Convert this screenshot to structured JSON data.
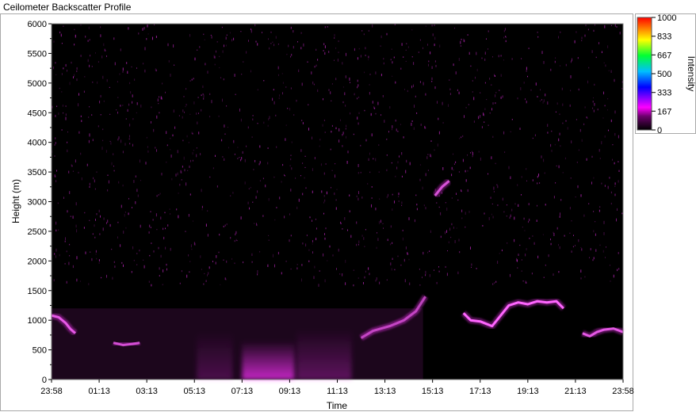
{
  "window": {
    "title": "Ceilometer Backscatter Profile"
  },
  "colors": {
    "background": "#000000",
    "accent": "#ff33ff",
    "colormap": [
      "#000000",
      "#6a006a",
      "#ff00ff",
      "#0000ff",
      "#00ffff",
      "#00ff00",
      "#ffff00",
      "#ff0000"
    ]
  },
  "chart_data": {
    "type": "heatmap",
    "title": "Ceilometer Backscatter Profile",
    "xlabel": "Time",
    "ylabel": "Height (m)",
    "x_ticks": [
      "23:58",
      "01:13",
      "03:13",
      "05:13",
      "07:13",
      "09:13",
      "11:13",
      "13:13",
      "15:13",
      "17:13",
      "19:13",
      "21:13",
      "23:58"
    ],
    "y_ticks": [
      0,
      500,
      1000,
      1500,
      2000,
      2500,
      3000,
      3500,
      4000,
      4500,
      5000,
      5500,
      6000
    ],
    "ylim": [
      0,
      6000
    ],
    "colorbar": {
      "label": "Intensity",
      "range": [
        0,
        1000
      ],
      "ticks": [
        0,
        167,
        333,
        500,
        667,
        833,
        1000
      ]
    },
    "layers": [
      {
        "feature": "boundary layer",
        "hours": [
          0,
          15.6
        ],
        "top_m": 1200,
        "intensity": 120
      }
    ],
    "cloud_base": [
      {
        "x": [
          0,
          0.3,
          0.6,
          0.8,
          1.0
        ],
        "y": [
          1080,
          1050,
          950,
          850,
          780
        ],
        "intensity": 420
      },
      {
        "x": [
          2.6,
          3.0,
          3.4,
          3.7
        ],
        "y": [
          620,
          580,
          600,
          620
        ],
        "intensity": 350
      },
      {
        "x": [
          13.0,
          13.5,
          14.2,
          14.8,
          15.3,
          15.7
        ],
        "y": [
          700,
          820,
          900,
          1000,
          1150,
          1400
        ],
        "intensity": 300
      },
      {
        "x": [
          16.1,
          16.4,
          16.7
        ],
        "y": [
          3100,
          3250,
          3350
        ],
        "intensity": 380
      },
      {
        "x": [
          17.3,
          17.6,
          18.0,
          18.5,
          18.8,
          19.2,
          19.6,
          20.0,
          20.4,
          20.8,
          21.2,
          21.5
        ],
        "y": [
          1120,
          1000,
          980,
          900,
          1050,
          1250,
          1300,
          1270,
          1320,
          1300,
          1320,
          1200
        ],
        "intensity": 520
      },
      {
        "x": [
          22.3,
          22.6,
          22.9,
          23.2,
          23.6,
          24.0
        ],
        "y": [
          780,
          730,
          800,
          840,
          860,
          800
        ],
        "intensity": 420
      }
    ],
    "aerosol_plumes": [
      {
        "hours": [
          8.0,
          10.2
        ],
        "top_m": 650,
        "intensity": 780
      },
      {
        "hours": [
          10.3,
          12.6
        ],
        "top_m": 850,
        "intensity": 300
      },
      {
        "hours": [
          6.1,
          7.6
        ],
        "top_m": 800,
        "intensity": 220
      }
    ]
  }
}
